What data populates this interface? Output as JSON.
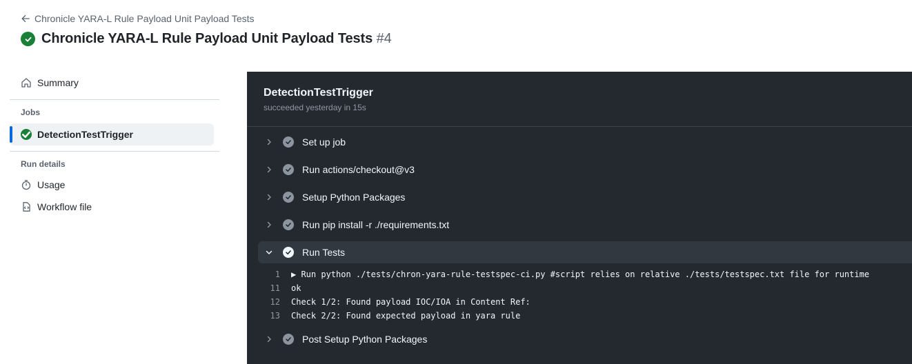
{
  "header": {
    "back_link": "Chronicle YARA-L Rule Payload Unit Payload Tests",
    "title": "Chronicle YARA-L Rule Payload Unit Payload Tests",
    "run_number": "#4",
    "status": "success"
  },
  "sidebar": {
    "summary": "Summary",
    "jobs_heading": "Jobs",
    "job": "DetectionTestTrigger",
    "run_details_heading": "Run details",
    "usage": "Usage",
    "workflow_file": "Workflow file"
  },
  "job_panel": {
    "name": "DetectionTestTrigger",
    "meta": "succeeded yesterday in 15s",
    "steps": [
      {
        "label": "Set up job",
        "expanded": false
      },
      {
        "label": "Run actions/checkout@v3",
        "expanded": false
      },
      {
        "label": "Setup Python Packages",
        "expanded": false
      },
      {
        "label": "Run pip install -r ./requirements.txt",
        "expanded": false
      },
      {
        "label": "Run Tests",
        "expanded": true
      },
      {
        "label": "Post Setup Python Packages",
        "expanded": false
      }
    ],
    "log_lines": [
      {
        "num": "1",
        "text": "▶ Run python ./tests/chron-yara-rule-testspec-ci.py #script relies on relative ./tests/testspec.txt file for runtime"
      },
      {
        "num": "11",
        "text": "ok"
      },
      {
        "num": "12",
        "text": "Check 1/2: Found payload IOC/IOA in Content Ref:"
      },
      {
        "num": "13",
        "text": "Check 2/2: Found expected payload in yara rule"
      }
    ]
  },
  "colors": {
    "success": "#1a7f37",
    "accent": "#0969da",
    "log_bg": "#24292f"
  }
}
